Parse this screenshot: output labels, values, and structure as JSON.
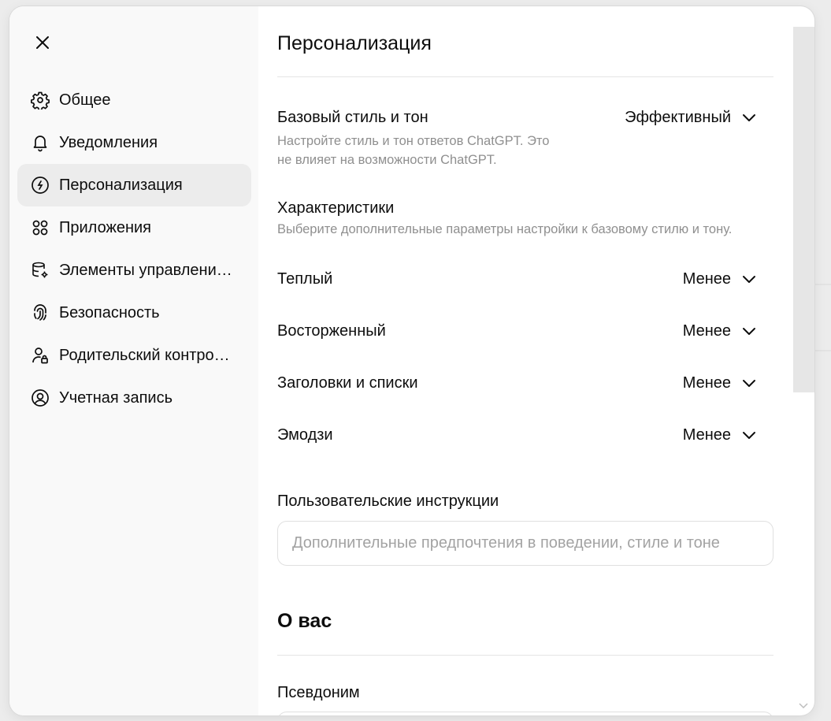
{
  "sidebar": {
    "items": [
      {
        "label": "Общее",
        "icon": "gear-icon"
      },
      {
        "label": "Уведомления",
        "icon": "bell-icon"
      },
      {
        "label": "Персонализация",
        "icon": "personalization-icon",
        "active": true
      },
      {
        "label": "Приложения",
        "icon": "apps-grid-icon"
      },
      {
        "label": "Элементы управлени…",
        "icon": "data-controls-icon"
      },
      {
        "label": "Безопасность",
        "icon": "fingerprint-icon"
      },
      {
        "label": "Родительский контро…",
        "icon": "user-lock-icon"
      },
      {
        "label": "Учетная запись",
        "icon": "user-circle-icon"
      }
    ]
  },
  "main": {
    "title": "Персонализация",
    "base_style": {
      "label": "Базовый стиль и тон",
      "description_line1": "Настройте стиль и тон ответов ChatGPT. Это",
      "description_line2": "не влияет на возможности ChatGPT.",
      "value": "Эффективный"
    },
    "characteristics": {
      "label": "Характеристики",
      "description": "Выберите дополнительные параметры настройки к базовому стилю и тону.",
      "items": [
        {
          "label": "Теплый",
          "value": "Менее"
        },
        {
          "label": "Восторженный",
          "value": "Менее"
        },
        {
          "label": "Заголовки и списки",
          "value": "Менее"
        },
        {
          "label": "Эмодзи",
          "value": "Менее"
        }
      ]
    },
    "custom_instructions": {
      "label": "Пользовательские инструкции",
      "placeholder": "Дополнительные предпочтения в поведении, стиле и тоне"
    },
    "about_you": {
      "title": "О вас",
      "nickname_label": "Псевдоним"
    }
  }
}
